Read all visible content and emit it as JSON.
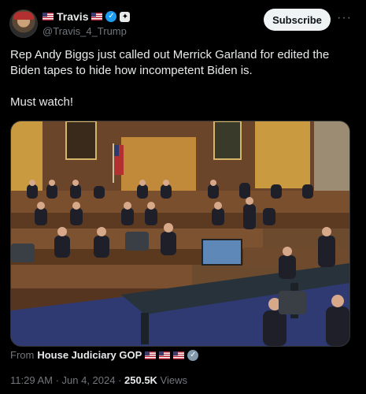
{
  "author": {
    "display_name": "Travis",
    "handle": "@Travis_4_Trump"
  },
  "actions": {
    "subscribe_label": "Subscribe",
    "more_label": "···"
  },
  "post": {
    "text_line1": "Rep Andy Biggs just called out Merrick Garland for edited the Biden tapes to hide how incompetent Biden is.",
    "text_line2": "Must watch!"
  },
  "source": {
    "prefix": "From",
    "name": "House Judiciary GOP"
  },
  "meta": {
    "time": "11:29 AM · Jun 4, 2024 · ",
    "views_count": "250.5K",
    "views_label": " Views"
  },
  "colors": {
    "background": "#000000",
    "verified": "#1d9bf0",
    "muted_text": "#71767b"
  }
}
